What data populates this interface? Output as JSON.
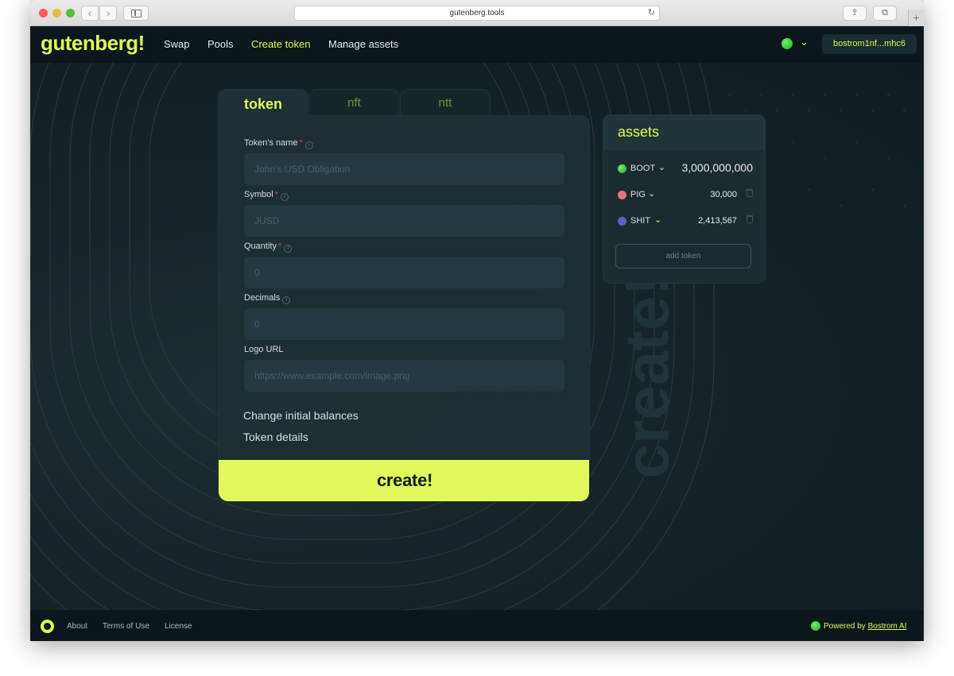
{
  "browser": {
    "url": "gutenberg.tools",
    "back_glyph": "‹",
    "forward_glyph": "›",
    "reload_glyph": "↻",
    "share_glyph": "⇪",
    "tabs_glyph": "⧉",
    "plus_glyph": "+"
  },
  "header": {
    "logo": "gutenberg!",
    "nav": [
      "Swap",
      "Pools",
      "Create token",
      "Manage assets"
    ],
    "active_nav": "Create token",
    "status_chevron": "⌄",
    "wallet": "bostrom1nf...mhc6"
  },
  "tabs": [
    "token",
    "nft",
    "ntt"
  ],
  "form": {
    "name_label": "Token's name",
    "name_placeholder": "John's USD Obligation",
    "symbol_label": "Symbol",
    "symbol_placeholder": "JUSD",
    "quantity_label": "Quantity",
    "quantity_placeholder": "0",
    "decimals_label": "Decimals",
    "decimals_placeholder": "0",
    "logo_label": "Logo URL",
    "logo_placeholder": "https://www.example.com/image.png",
    "required_mark": "*",
    "info_mark": "i",
    "change_balances": "Change initial balances",
    "token_details": "Token details",
    "create_label": "create!"
  },
  "watermark": "create!",
  "assets": {
    "title": "assets",
    "items": [
      {
        "name": "BOOT",
        "amount": "3,000,000,000",
        "icon": "green-dot-icon",
        "color": "#1fc21f"
      },
      {
        "name": "PIG",
        "amount": "30,000",
        "icon": "pig-icon",
        "color": "#e8707a"
      },
      {
        "name": "SHIT",
        "amount": "2,413,567",
        "icon": "globe-icon",
        "color": "#5c5fc9"
      }
    ],
    "chevron": "⌄",
    "add_label": "add token"
  },
  "footer": {
    "links": [
      "About",
      "Terms of Use",
      "License"
    ],
    "powered_prefix": "Powered by ",
    "powered_link": "Bostrom AI"
  },
  "colors": {
    "accent": "#dff758",
    "background": "#0f1d22",
    "card": "#1e3035"
  }
}
